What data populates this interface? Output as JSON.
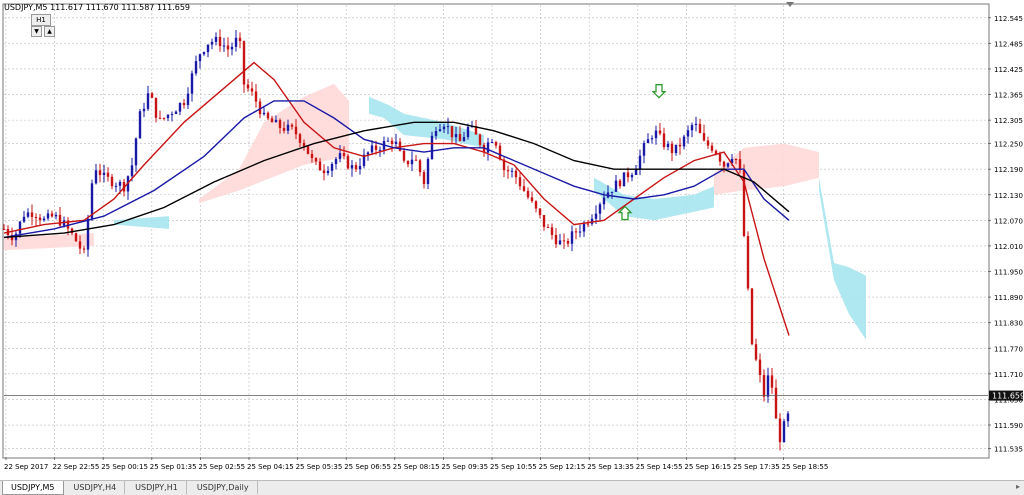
{
  "window": {
    "header": "USDJPY,M5  111.617 111.670 111.587 111.659"
  },
  "timeframe_badge": "H1",
  "tabs": [
    {
      "label": "USDJPY,M5",
      "active": true
    },
    {
      "label": "USDJPY,H4",
      "active": false
    },
    {
      "label": "USDJPY,H1",
      "active": false
    },
    {
      "label": "USDJPY,Daily",
      "active": false
    }
  ],
  "colors": {
    "bull": "#1a1aa6",
    "bear": "#c81414",
    "ma_fast": "#c81414",
    "ma_mid": "#1a1aa6",
    "ma_slow": "#000000",
    "cloud_bull": "#a6e6ee",
    "cloud_bear": "#ffd9d9",
    "grid": "#bbbbbb",
    "arrow": "#2e9b2e"
  },
  "chart_data": {
    "type": "candlestick",
    "symbol": "USDJPY",
    "timeframe": "M5",
    "current_price": 111.659,
    "ylim": [
      111.515,
      112.575
    ],
    "y_ticks": [
      112.545,
      112.485,
      112.425,
      112.365,
      112.305,
      112.25,
      112.19,
      112.13,
      112.07,
      112.01,
      111.95,
      111.89,
      111.83,
      111.77,
      111.71,
      111.65,
      111.59,
      111.535
    ],
    "x_labels": [
      "22 Sep 2017",
      "22 Sep 22:55",
      "25 Sep 00:15",
      "25 Sep 01:35",
      "25 Sep 02:55",
      "25 Sep 04:15",
      "25 Sep 05:35",
      "25 Sep 06:55",
      "25 Sep 08:15",
      "25 Sep 09:35",
      "25 Sep 10:55",
      "25 Sep 12:15",
      "25 Sep 13:35",
      "25 Sep 14:55",
      "25 Sep 16:15",
      "25 Sep 17:35",
      "25 Sep 18:55"
    ],
    "price_path": [
      [
        0,
        112.05
      ],
      [
        10,
        112.03
      ],
      [
        20,
        112.085
      ],
      [
        30,
        112.09
      ],
      [
        40,
        112.07
      ],
      [
        50,
        112.08
      ],
      [
        60,
        112.06
      ],
      [
        70,
        112.03
      ],
      [
        80,
        111.99
      ],
      [
        90,
        112.2
      ],
      [
        100,
        112.17
      ],
      [
        110,
        112.16
      ],
      [
        120,
        112.15
      ],
      [
        128,
        112.2
      ],
      [
        135,
        112.31
      ],
      [
        145,
        112.37
      ],
      [
        155,
        112.3
      ],
      [
        170,
        112.33
      ],
      [
        180,
        112.35
      ],
      [
        195,
        112.46
      ],
      [
        205,
        112.49
      ],
      [
        215,
        112.49
      ],
      [
        225,
        112.47
      ],
      [
        235,
        112.5
      ],
      [
        240,
        112.39
      ],
      [
        250,
        112.36
      ],
      [
        260,
        112.31
      ],
      [
        275,
        112.29
      ],
      [
        290,
        112.28
      ],
      [
        300,
        112.25
      ],
      [
        310,
        112.2
      ],
      [
        320,
        112.19
      ],
      [
        335,
        112.22
      ],
      [
        350,
        112.19
      ],
      [
        365,
        112.23
      ],
      [
        380,
        112.25
      ],
      [
        390,
        112.26
      ],
      [
        400,
        112.2
      ],
      [
        410,
        112.22
      ],
      [
        420,
        112.16
      ],
      [
        430,
        112.29
      ],
      [
        440,
        112.3
      ],
      [
        455,
        112.25
      ],
      [
        465,
        112.29
      ],
      [
        480,
        112.24
      ],
      [
        490,
        112.27
      ],
      [
        500,
        112.19
      ],
      [
        510,
        112.18
      ],
      [
        520,
        112.14
      ],
      [
        530,
        112.1
      ],
      [
        540,
        112.06
      ],
      [
        550,
        112.03
      ],
      [
        560,
        112.01
      ],
      [
        570,
        112.04
      ],
      [
        580,
        112.06
      ],
      [
        590,
        112.09
      ],
      [
        600,
        112.13
      ],
      [
        610,
        112.15
      ],
      [
        620,
        112.17
      ],
      [
        630,
        112.19
      ],
      [
        640,
        112.24
      ],
      [
        650,
        112.28
      ],
      [
        660,
        112.25
      ],
      [
        670,
        112.23
      ],
      [
        680,
        112.26
      ],
      [
        690,
        112.3
      ],
      [
        700,
        112.25
      ],
      [
        710,
        112.24
      ],
      [
        720,
        112.2
      ],
      [
        730,
        112.23
      ],
      [
        736,
        112.18
      ],
      [
        742,
        111.96
      ],
      [
        748,
        111.78
      ],
      [
        754,
        111.72
      ],
      [
        760,
        111.66
      ],
      [
        766,
        111.72
      ],
      [
        772,
        111.6
      ],
      [
        776,
        111.56
      ],
      [
        782,
        111.6
      ],
      [
        786,
        111.62
      ]
    ],
    "ma_fast": [
      [
        0,
        112.04
      ],
      [
        40,
        112.06
      ],
      [
        80,
        112.07
      ],
      [
        110,
        112.12
      ],
      [
        140,
        112.2
      ],
      [
        180,
        112.3
      ],
      [
        220,
        112.38
      ],
      [
        250,
        112.44
      ],
      [
        270,
        112.4
      ],
      [
        300,
        112.3
      ],
      [
        330,
        112.24
      ],
      [
        360,
        112.22
      ],
      [
        390,
        112.24
      ],
      [
        420,
        112.25
      ],
      [
        450,
        112.25
      ],
      [
        480,
        112.23
      ],
      [
        510,
        112.2
      ],
      [
        540,
        112.12
      ],
      [
        570,
        112.06
      ],
      [
        600,
        112.07
      ],
      [
        630,
        112.12
      ],
      [
        660,
        112.17
      ],
      [
        690,
        112.21
      ],
      [
        720,
        112.23
      ],
      [
        740,
        112.16
      ],
      [
        760,
        111.98
      ],
      [
        785,
        111.8
      ]
    ],
    "ma_mid": [
      [
        0,
        112.03
      ],
      [
        50,
        112.05
      ],
      [
        100,
        112.08
      ],
      [
        150,
        112.14
      ],
      [
        200,
        112.22
      ],
      [
        240,
        112.31
      ],
      [
        270,
        112.35
      ],
      [
        300,
        112.35
      ],
      [
        330,
        112.31
      ],
      [
        360,
        112.26
      ],
      [
        390,
        112.24
      ],
      [
        420,
        112.23
      ],
      [
        450,
        112.24
      ],
      [
        480,
        112.24
      ],
      [
        510,
        112.21
      ],
      [
        540,
        112.18
      ],
      [
        570,
        112.15
      ],
      [
        600,
        112.13
      ],
      [
        630,
        112.12
      ],
      [
        660,
        112.13
      ],
      [
        690,
        112.15
      ],
      [
        720,
        112.19
      ],
      [
        740,
        112.19
      ],
      [
        760,
        112.12
      ],
      [
        785,
        112.07
      ]
    ],
    "ma_slow": [
      [
        0,
        112.03
      ],
      [
        60,
        112.04
      ],
      [
        110,
        112.06
      ],
      [
        160,
        112.1
      ],
      [
        210,
        112.16
      ],
      [
        260,
        112.21
      ],
      [
        310,
        112.25
      ],
      [
        360,
        112.28
      ],
      [
        410,
        112.3
      ],
      [
        450,
        112.3
      ],
      [
        490,
        112.28
      ],
      [
        530,
        112.25
      ],
      [
        570,
        112.21
      ],
      [
        610,
        112.19
      ],
      [
        650,
        112.19
      ],
      [
        690,
        112.19
      ],
      [
        720,
        112.19
      ],
      [
        750,
        112.16
      ],
      [
        785,
        112.09
      ]
    ],
    "cloud_segments": [
      {
        "polarity": "bull",
        "points": [
          [
            110,
            112.07
          ],
          [
            165,
            112.08
          ],
          [
            165,
            112.05
          ],
          [
            110,
            112.06
          ]
        ]
      },
      {
        "polarity": "bear",
        "points": [
          [
            0,
            112.03
          ],
          [
            90,
            112.04
          ],
          [
            90,
            112.01
          ],
          [
            0,
            112.0
          ]
        ]
      },
      {
        "polarity": "bear",
        "points": [
          [
            195,
            112.12
          ],
          [
            235,
            112.19
          ],
          [
            260,
            112.3
          ],
          [
            300,
            112.36
          ],
          [
            330,
            112.39
          ],
          [
            345,
            112.35
          ],
          [
            345,
            112.22
          ],
          [
            300,
            112.2
          ],
          [
            235,
            112.14
          ],
          [
            195,
            112.11
          ]
        ]
      },
      {
        "polarity": "bull",
        "points": [
          [
            365,
            112.36
          ],
          [
            385,
            112.34
          ],
          [
            400,
            112.32
          ],
          [
            440,
            112.3
          ],
          [
            480,
            112.27
          ],
          [
            480,
            112.24
          ],
          [
            440,
            112.26
          ],
          [
            400,
            112.27
          ],
          [
            380,
            112.31
          ],
          [
            365,
            112.32
          ]
        ]
      },
      {
        "polarity": "bull",
        "points": [
          [
            590,
            112.17
          ],
          [
            620,
            112.13
          ],
          [
            650,
            112.12
          ],
          [
            690,
            112.13
          ],
          [
            710,
            112.15
          ],
          [
            710,
            112.1
          ],
          [
            690,
            112.09
          ],
          [
            650,
            112.07
          ],
          [
            620,
            112.08
          ],
          [
            590,
            112.14
          ]
        ]
      },
      {
        "polarity": "bear",
        "points": [
          [
            710,
            112.18
          ],
          [
            740,
            112.24
          ],
          [
            780,
            112.25
          ],
          [
            815,
            112.23
          ],
          [
            815,
            112.17
          ],
          [
            780,
            112.15
          ],
          [
            740,
            112.14
          ],
          [
            710,
            112.13
          ]
        ]
      },
      {
        "polarity": "bull",
        "points": [
          [
            815,
            112.17
          ],
          [
            830,
            111.97
          ],
          [
            845,
            111.96
          ],
          [
            862,
            111.94
          ],
          [
            862,
            111.79
          ],
          [
            845,
            111.85
          ],
          [
            830,
            111.93
          ],
          [
            815,
            112.14
          ]
        ]
      }
    ],
    "signals": [
      {
        "kind": "down",
        "x_index": 655,
        "price": 112.36
      },
      {
        "kind": "up",
        "x_index": 621,
        "price": 112.1
      }
    ]
  }
}
